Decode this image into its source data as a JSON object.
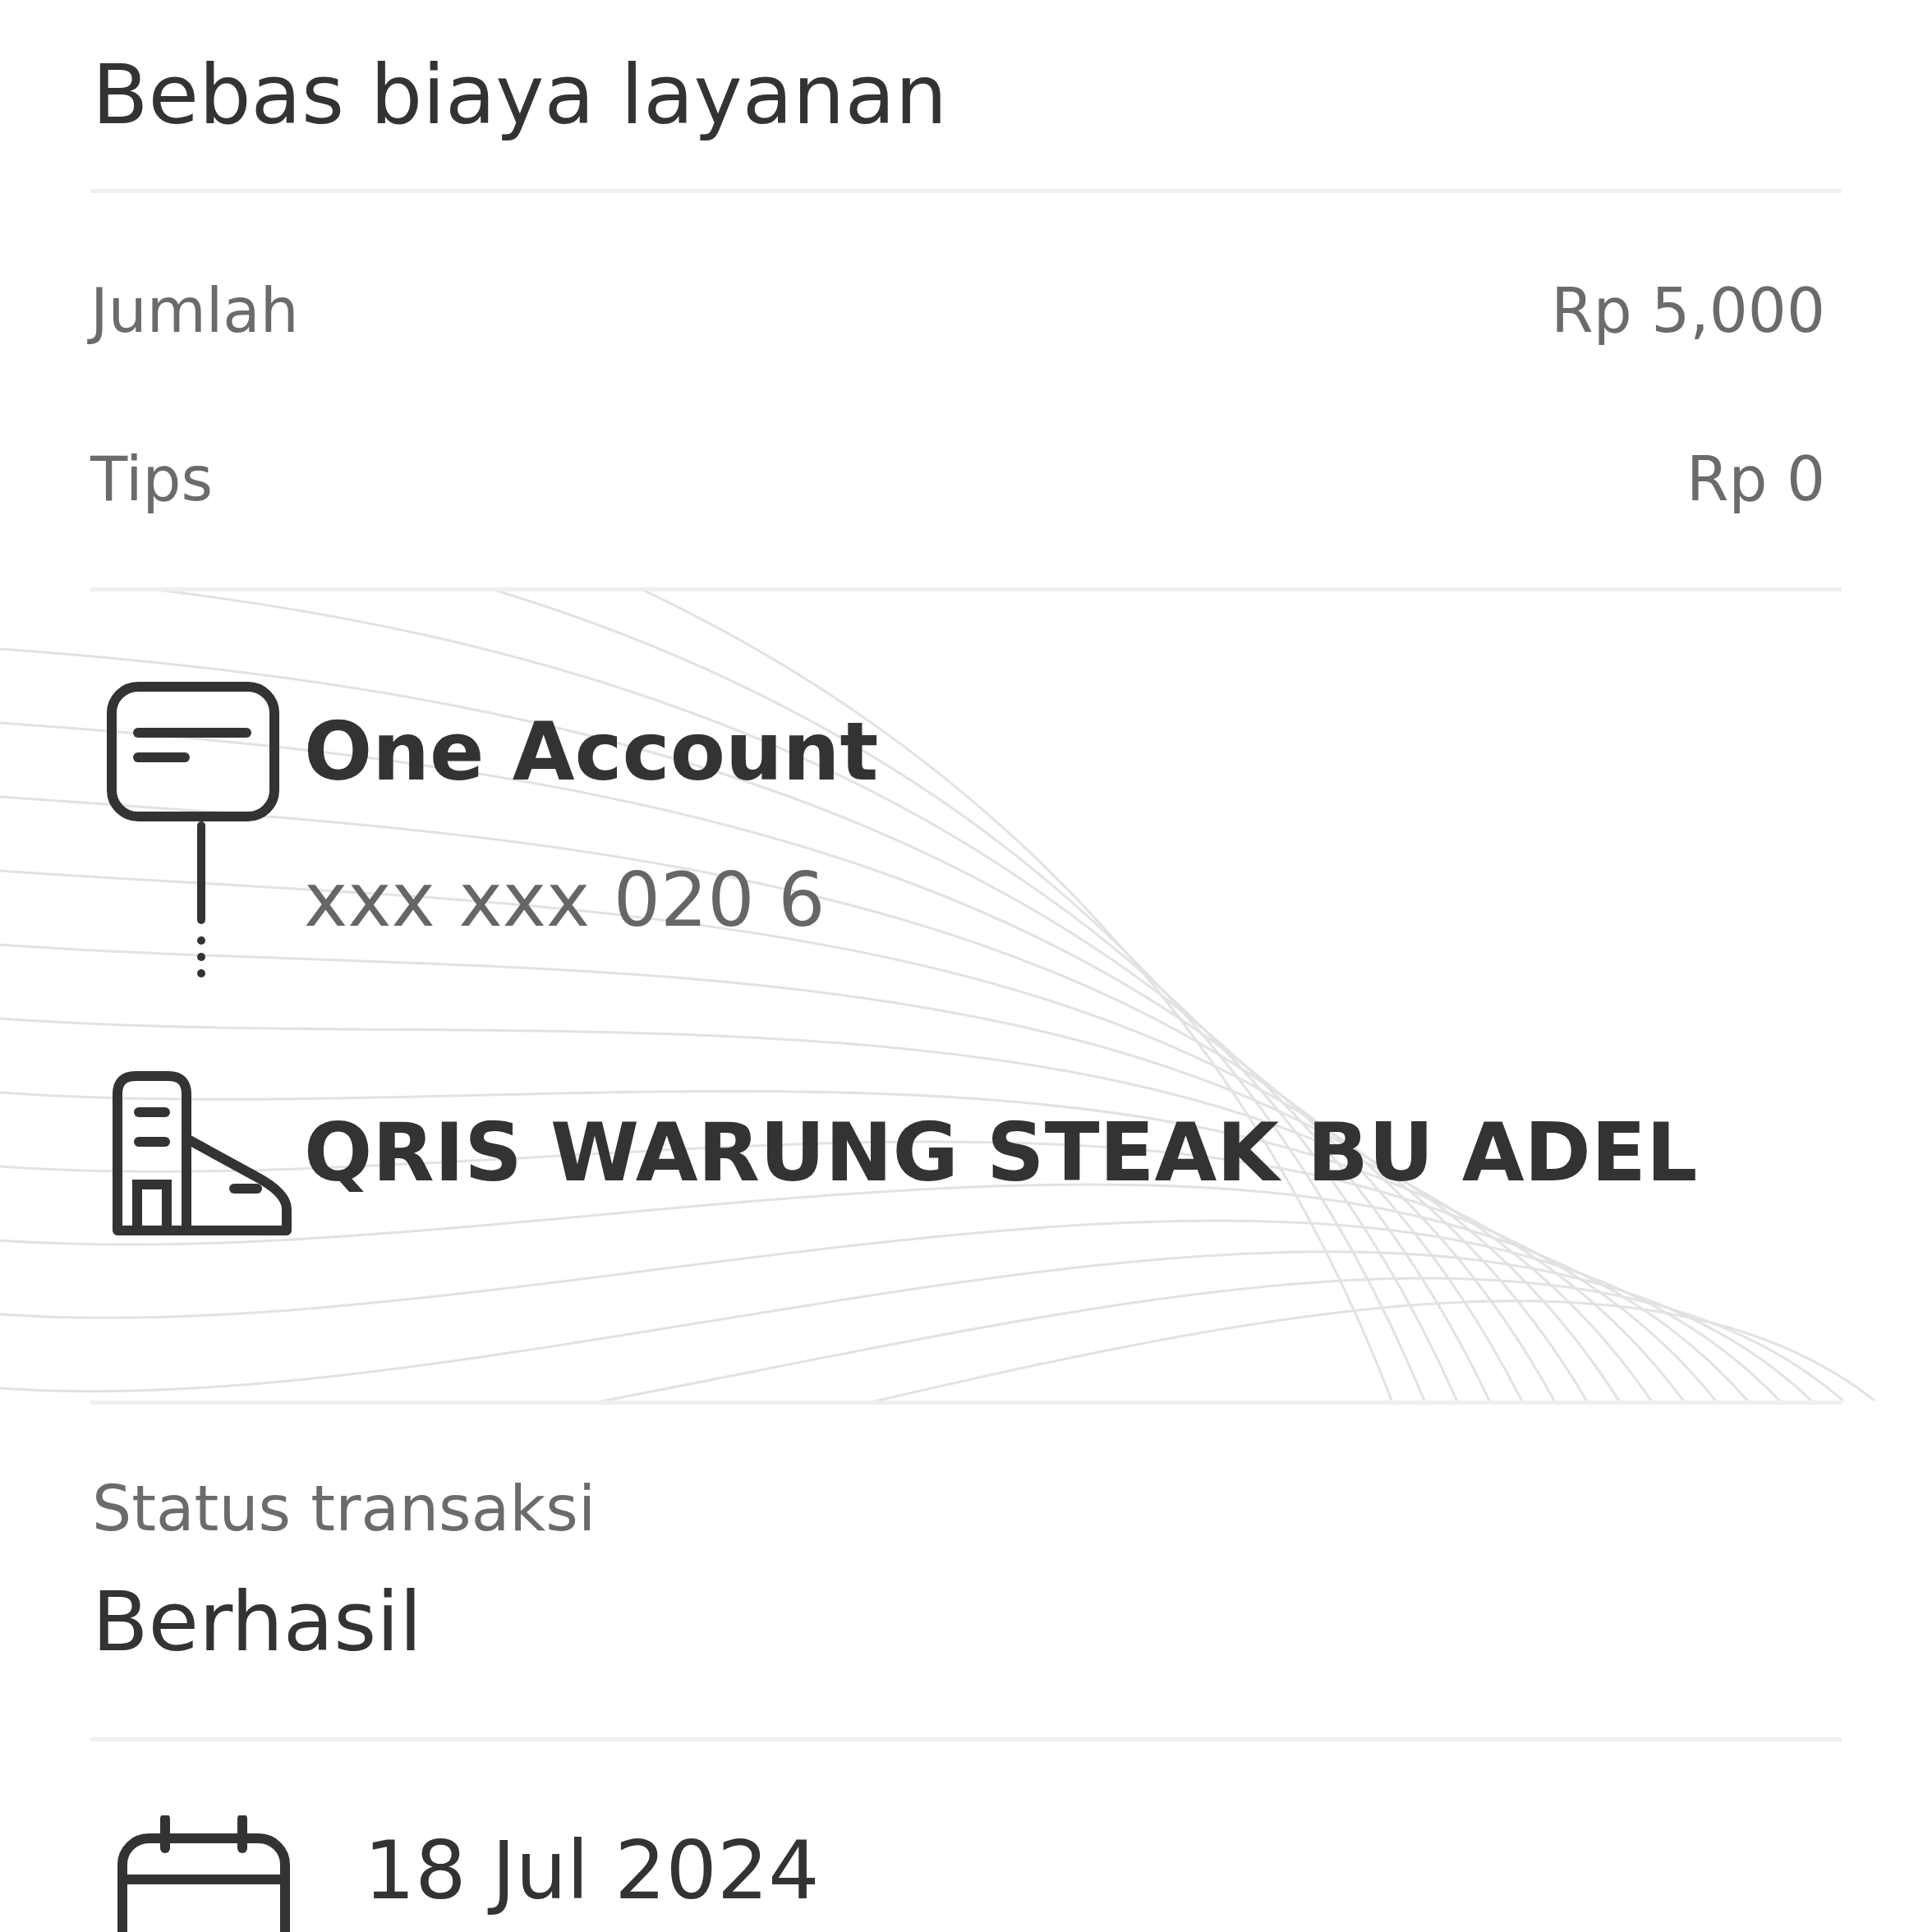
{
  "fee_note": "Bebas biaya layanan",
  "amounts": [
    {
      "label": "Jumlah",
      "value": "Rp 5,000"
    },
    {
      "label": "Tips",
      "value": "Rp 0"
    }
  ],
  "transfer": {
    "source_name": "One Account",
    "source_number": "xxx xxx 020 6",
    "destination_name": "QRIS WARUNG STEAK BU ADEL"
  },
  "status": {
    "label": "Status transaksi",
    "value": "Berhasil"
  },
  "date": "18 Jul 2024"
}
